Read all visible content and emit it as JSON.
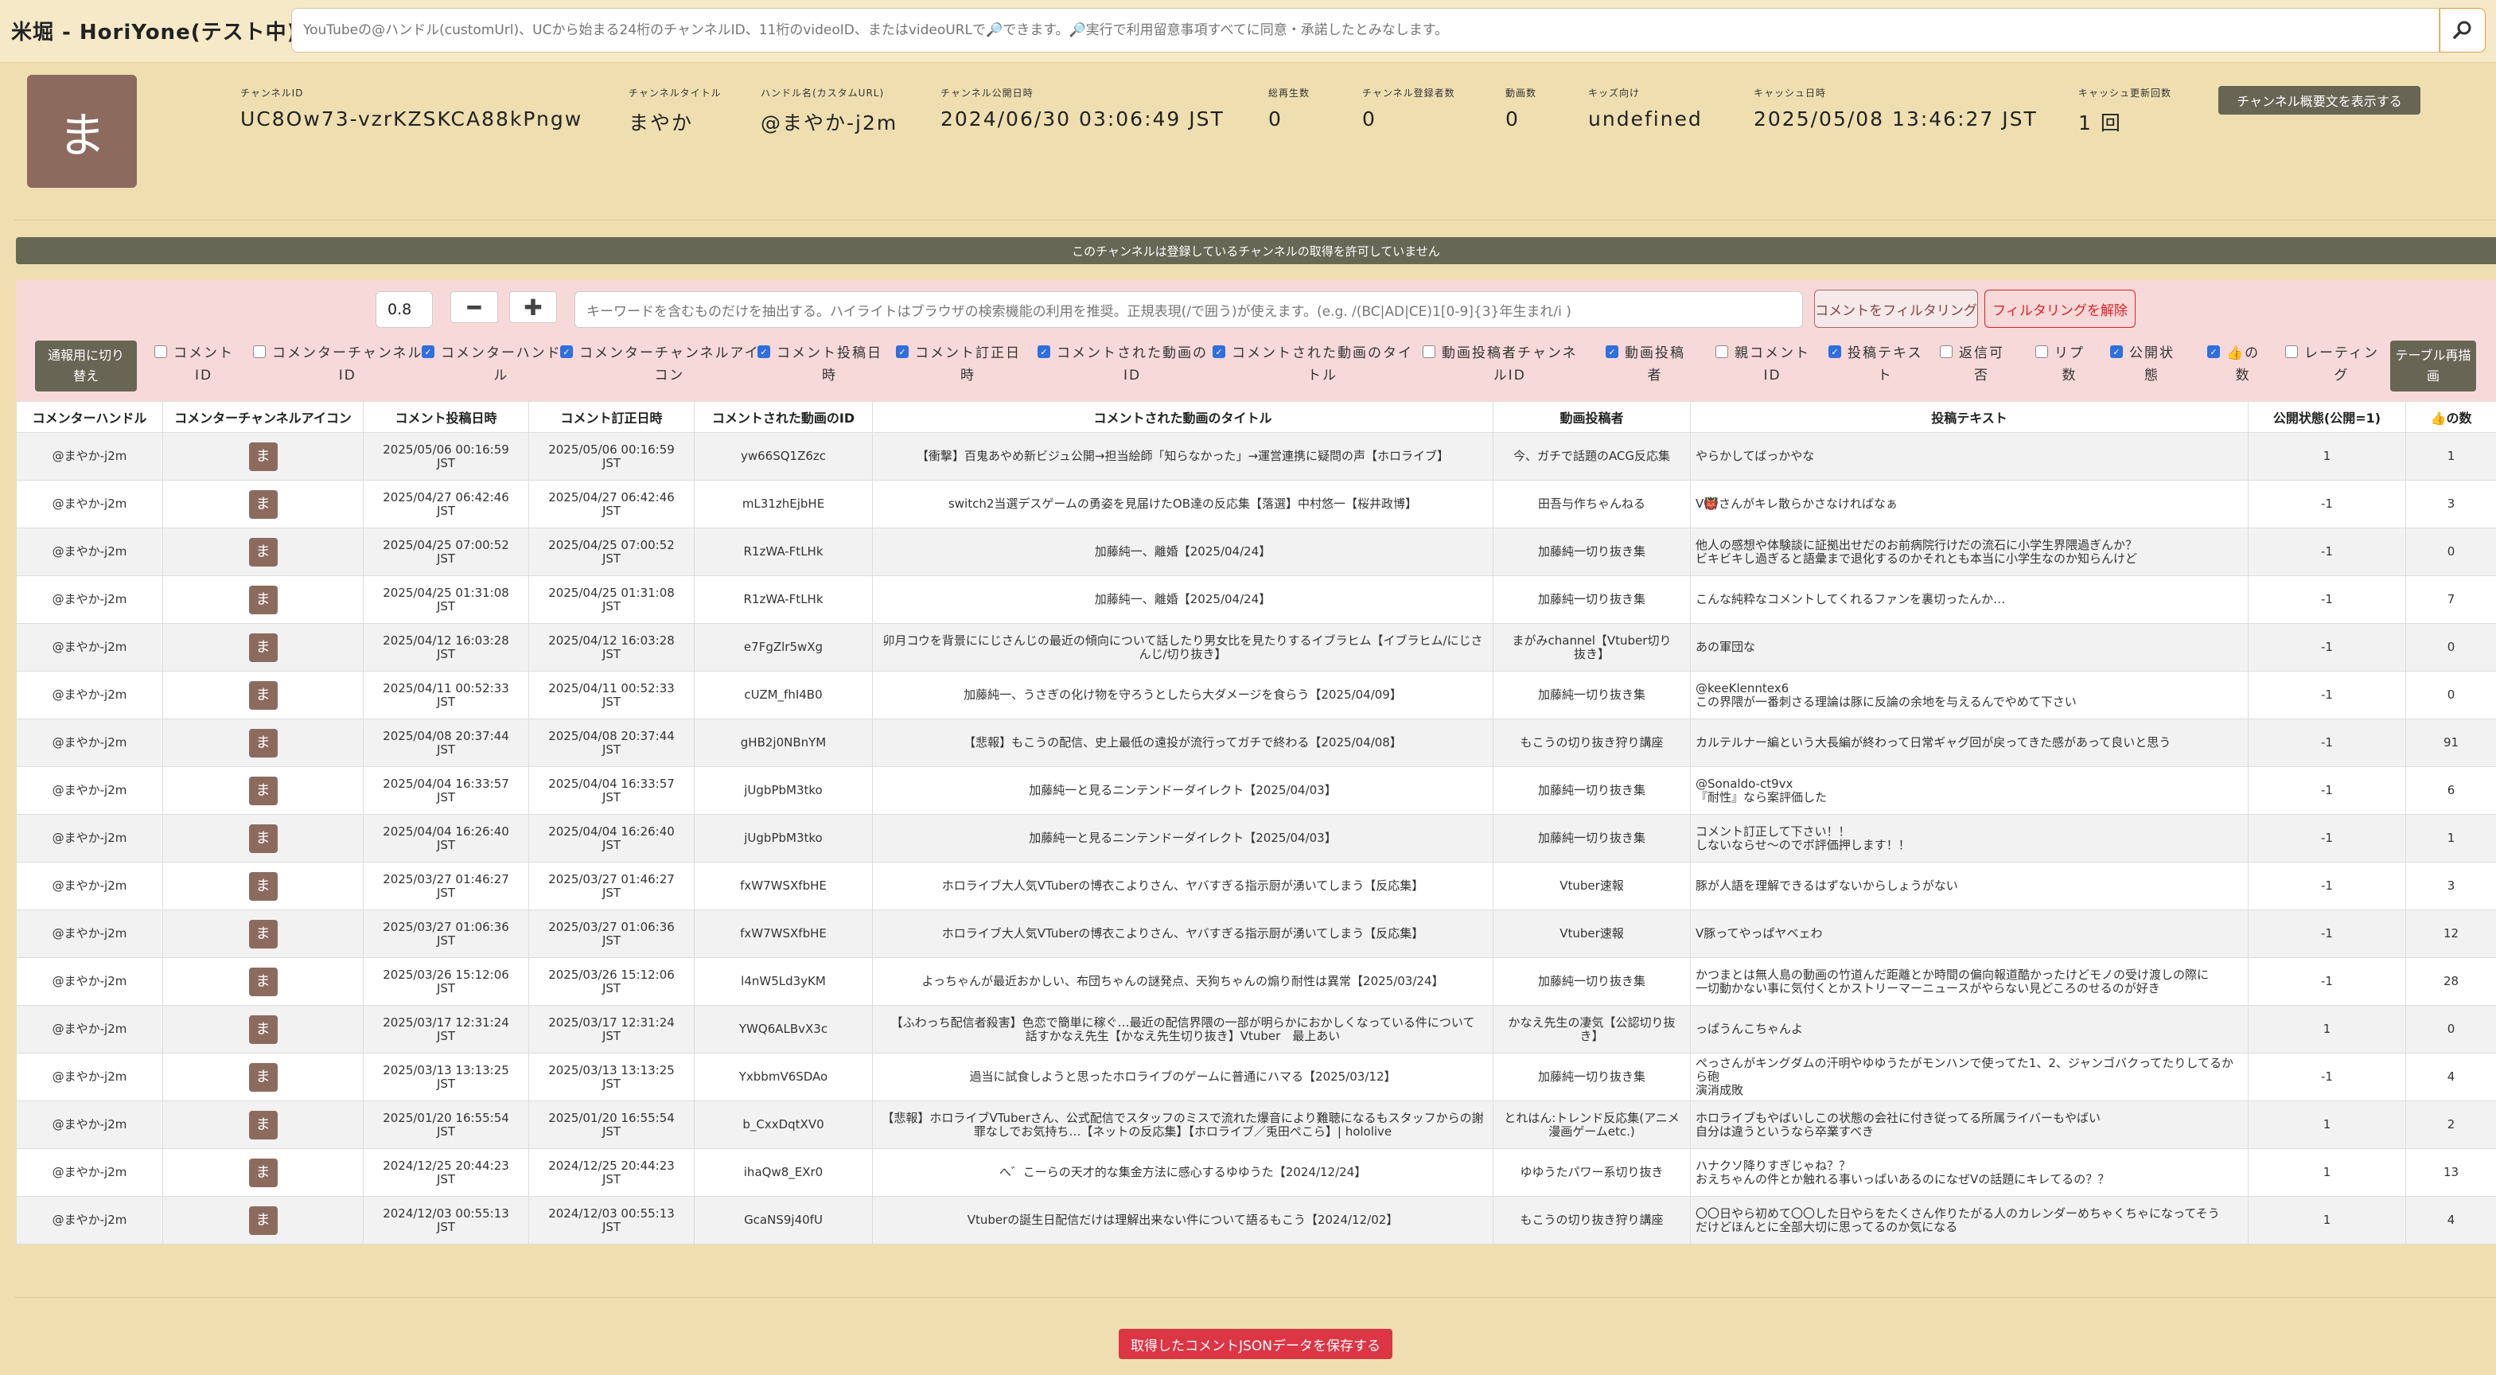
{
  "header": {
    "title": "米堀 - HoriYone(テスト中)",
    "search_placeholder": "YouTubeの@ハンドル(customUrl)、UCから始まる24桁のチャンネルID、11桁のvideoID、またはvideoURLで🔎できます。🔎実行で利用留意事項すべてに同意・承諾したとみなします。",
    "search_icon": "magnifier-icon"
  },
  "channel": {
    "avatar_char": "ま",
    "fields": [
      {
        "label": "チャンネルID",
        "value": "UC8Ow73-vzrKZSKCA88kPngw"
      },
      {
        "label": "チャンネルタイトル",
        "value": "まやか"
      },
      {
        "label": "ハンドル名(カスタムURL)",
        "value": "@まやか-j2m"
      },
      {
        "label": "チャンネル公開日時",
        "value": "2024/06/30 03:06:49 JST"
      },
      {
        "label": "総再生数",
        "value": "0"
      },
      {
        "label": "チャンネル登録者数",
        "value": "0"
      },
      {
        "label": "動画数",
        "value": "0"
      },
      {
        "label": "キッズ向け",
        "value": "undefined"
      },
      {
        "label": "キャッシュ日時",
        "value": "2025/05/08 13:46:27 JST"
      },
      {
        "label": "キャッシュ更新回数",
        "value": "1 回"
      }
    ],
    "description_button": "チャンネル概要文を表示する"
  },
  "notice": "このチャンネルは登録しているチャンネルの取得を許可していません",
  "filter": {
    "threshold": "0.8",
    "minus": "━",
    "plus": "✚",
    "keyword_placeholder": "キーワードを含むものだけを抽出する。ハイライトはブラウザの検索機能の利用を推奨。正規表現(/で囲う)が使えます。(e.g. /(BC|AD|CE)1[0-9]{3}年生まれ/i )",
    "filter_button": "コメントをフィルタリング",
    "clear_button": "フィルタリングを解除",
    "switch_button_l1": "通報用に切り",
    "switch_button_l2": "替え",
    "redraw_button_l1": "テーブル再描",
    "redraw_button_l2": "画"
  },
  "column_toggles": [
    {
      "l1": "コメント",
      "l2": "ID",
      "checked": false
    },
    {
      "l1": "コメンターチャンネル",
      "l2": "ID",
      "checked": false
    },
    {
      "l1": "コメンターハンド",
      "l2": "ル",
      "checked": true
    },
    {
      "l1": "コメンターチャンネルアイ",
      "l2": "コン",
      "checked": true
    },
    {
      "l1": "コメント投稿日",
      "l2": "時",
      "checked": true
    },
    {
      "l1": "コメント訂正日",
      "l2": "時",
      "checked": true
    },
    {
      "l1": "コメントされた動画の",
      "l2": "ID",
      "checked": true
    },
    {
      "l1": "コメントされた動画のタイ",
      "l2": "トル",
      "checked": true
    },
    {
      "l1": "動画投稿者チャンネ",
      "l2": "ルID",
      "checked": false
    },
    {
      "l1": "動画投稿",
      "l2": "者",
      "checked": true
    },
    {
      "l1": "親コメント",
      "l2": "ID",
      "checked": false
    },
    {
      "l1": "投稿テキス",
      "l2": "ト",
      "checked": true
    },
    {
      "l1": "返信可",
      "l2": "否",
      "checked": false
    },
    {
      "l1": "リプ",
      "l2": "数",
      "checked": false
    },
    {
      "l1": "公開状",
      "l2": "態",
      "checked": true
    },
    {
      "l1": "👍の",
      "l2": "数",
      "checked": true
    },
    {
      "l1": "レーティン",
      "l2": "グ",
      "checked": false
    }
  ],
  "table": {
    "headers": [
      "コメンターハンドル",
      "コメンターチャンネルアイコン",
      "コメント投稿日時",
      "コメント訂正日時",
      "コメントされた動画のID",
      "コメントされた動画のタイトル",
      "動画投稿者",
      "投稿テキスト",
      "公開状態(公開=1)",
      "👍の数"
    ],
    "rows": [
      {
        "handle": "@まやか-j2m",
        "icon": "ま",
        "posted_d": "2025/05/06 00:16:59",
        "posted_t": "JST",
        "edited_d": "2025/05/06 00:16:59",
        "edited_t": "JST",
        "video_id": "yw66SQ1Z6zc",
        "title1": "【衝撃】百鬼あやめ新ビジュ公開→担当絵師「知らなかった」→運営連携に疑問の声【ホロライブ】",
        "title2": "",
        "uploader1": "今、ガチで話題のACG反応集",
        "uploader2": "",
        "text1": "やらかしてばっかやな",
        "text2": "",
        "status": "1",
        "likes": "1"
      },
      {
        "handle": "@まやか-j2m",
        "icon": "ま",
        "posted_d": "2025/04/27 06:42:46",
        "posted_t": "JST",
        "edited_d": "2025/04/27 06:42:46",
        "edited_t": "JST",
        "video_id": "mL31zhEjbHE",
        "title1": "switch2当選デスゲームの勇姿を見届けたOB達の反応集【落選】中村悠一【桜井政博】",
        "title2": "",
        "uploader1": "田吾与作ちゃんねる",
        "uploader2": "",
        "text1": "V👹さんがキレ散らかさなければなぁ",
        "text2": "",
        "status": "-1",
        "likes": "3"
      },
      {
        "handle": "@まやか-j2m",
        "icon": "ま",
        "posted_d": "2025/04/25 07:00:52",
        "posted_t": "JST",
        "edited_d": "2025/04/25 07:00:52",
        "edited_t": "JST",
        "video_id": "R1zWA-FtLHk",
        "title1": "加藤純一、離婚【2025/04/24】",
        "title2": "",
        "uploader1": "加藤純一切り抜き集",
        "uploader2": "",
        "text1": "他人の感想や体験談に証拠出せだのお前病院行けだの流石に小学生界隈過ぎんか？",
        "text2": "ビキビキし過ぎると語彙まで退化するのかそれとも本当に小学生なのか知らんけど",
        "status": "-1",
        "likes": "0"
      },
      {
        "handle": "@まやか-j2m",
        "icon": "ま",
        "posted_d": "2025/04/25 01:31:08",
        "posted_t": "JST",
        "edited_d": "2025/04/25 01:31:08",
        "edited_t": "JST",
        "video_id": "R1zWA-FtLHk",
        "title1": "加藤純一、離婚【2025/04/24】",
        "title2": "",
        "uploader1": "加藤純一切り抜き集",
        "uploader2": "",
        "text1": "こんな純粋なコメントしてくれるファンを裏切ったんか…",
        "text2": "",
        "status": "-1",
        "likes": "7"
      },
      {
        "handle": "@まやか-j2m",
        "icon": "ま",
        "posted_d": "2025/04/12 16:03:28",
        "posted_t": "JST",
        "edited_d": "2025/04/12 16:03:28",
        "edited_t": "JST",
        "video_id": "e7FgZlr5wXg",
        "title1": "卯月コウを背景ににじさんじの最近の傾向について話したり男女比を見たりするイブラヒム【イブラヒム/にじさ",
        "title2": "んじ/切り抜き】",
        "uploader1": "まがみchannel【Vtuber切り",
        "uploader2": "抜き】",
        "text1": "あの軍団な",
        "text2": "",
        "status": "-1",
        "likes": "0"
      },
      {
        "handle": "@まやか-j2m",
        "icon": "ま",
        "posted_d": "2025/04/11 00:52:33",
        "posted_t": "JST",
        "edited_d": "2025/04/11 00:52:33",
        "edited_t": "JST",
        "video_id": "cUZM_fhI4B0",
        "title1": "加藤純一、うさぎの化け物を守ろうとしたら大ダメージを食らう【2025/04/09】",
        "title2": "",
        "uploader1": "加藤純一切り抜き集",
        "uploader2": "",
        "text1": "@keeKlenntex6",
        "text2": "この界隈が一番刺さる理論は豚に反論の余地を与えるんでやめて下さい",
        "status": "-1",
        "likes": "0"
      },
      {
        "handle": "@まやか-j2m",
        "icon": "ま",
        "posted_d": "2025/04/08 20:37:44",
        "posted_t": "JST",
        "edited_d": "2025/04/08 20:37:44",
        "edited_t": "JST",
        "video_id": "gHB2j0NBnYM",
        "title1": "【悲報】もこうの配信、史上最低の遠投が流行ってガチで終わる【2025/04/08】",
        "title2": "",
        "uploader1": "もこうの切り抜き狩り講座",
        "uploader2": "",
        "text1": "カルテルナー編という大長編が終わって日常ギャグ回が戻ってきた感があって良いと思う",
        "text2": "",
        "status": "-1",
        "likes": "91"
      },
      {
        "handle": "@まやか-j2m",
        "icon": "ま",
        "posted_d": "2025/04/04 16:33:57",
        "posted_t": "JST",
        "edited_d": "2025/04/04 16:33:57",
        "edited_t": "JST",
        "video_id": "jUgbPbM3tko",
        "title1": "加藤純一と見るニンテンドーダイレクト【2025/04/03】",
        "title2": "",
        "uploader1": "加藤純一切り抜き集",
        "uploader2": "",
        "text1": "@Sonaldo-ct9vx",
        "text2": "『耐性』なら案評価した",
        "status": "-1",
        "likes": "6"
      },
      {
        "handle": "@まやか-j2m",
        "icon": "ま",
        "posted_d": "2025/04/04 16:26:40",
        "posted_t": "JST",
        "edited_d": "2025/04/04 16:26:40",
        "edited_t": "JST",
        "video_id": "jUgbPbM3tko",
        "title1": "加藤純一と見るニンテンドーダイレクト【2025/04/03】",
        "title2": "",
        "uploader1": "加藤純一切り抜き集",
        "uploader2": "",
        "text1": "コメント訂正して下さい！！",
        "text2": "しないならせ〜のでボ評価押します！！",
        "status": "-1",
        "likes": "1"
      },
      {
        "handle": "@まやか-j2m",
        "icon": "ま",
        "posted_d": "2025/03/27 01:46:27",
        "posted_t": "JST",
        "edited_d": "2025/03/27 01:46:27",
        "edited_t": "JST",
        "video_id": "fxW7WSXfbHE",
        "title1": "ホロライブ大人気VTuberの博衣こよりさん、ヤバすぎる指示厨が湧いてしまう【反応集】",
        "title2": "",
        "uploader1": "Vtuber速報",
        "uploader2": "",
        "text1": "豚が人語を理解できるはずないからしょうがない",
        "text2": "",
        "status": "-1",
        "likes": "3"
      },
      {
        "handle": "@まやか-j2m",
        "icon": "ま",
        "posted_d": "2025/03/27 01:06:36",
        "posted_t": "JST",
        "edited_d": "2025/03/27 01:06:36",
        "edited_t": "JST",
        "video_id": "fxW7WSXfbHE",
        "title1": "ホロライブ大人気VTuberの博衣こよりさん、ヤバすぎる指示厨が湧いてしまう【反応集】",
        "title2": "",
        "uploader1": "Vtuber速報",
        "uploader2": "",
        "text1": "V豚ってやっぱヤベェわ",
        "text2": "",
        "status": "-1",
        "likes": "12"
      },
      {
        "handle": "@まやか-j2m",
        "icon": "ま",
        "posted_d": "2025/03/26 15:12:06",
        "posted_t": "JST",
        "edited_d": "2025/03/26 15:12:06",
        "edited_t": "JST",
        "video_id": "l4nW5Ld3yKM",
        "title1": "よっちゃんが最近おかしい、布団ちゃんの謎発点、天狗ちゃんの煽り耐性は異常【2025/03/24】",
        "title2": "",
        "uploader1": "加藤純一切り抜き集",
        "uploader2": "",
        "text1": "かつまとは無人島の動画の竹道んだ距離とか時間の偏向報道酷かったけどモノの受け渡しの際に",
        "text2": "一切動かない事に気付くとかストリーマーニュースがやらない見どころのせるのが好き",
        "status": "-1",
        "likes": "28"
      },
      {
        "handle": "@まやか-j2m",
        "icon": "ま",
        "posted_d": "2025/03/17 12:31:24",
        "posted_t": "JST",
        "edited_d": "2025/03/17 12:31:24",
        "edited_t": "JST",
        "video_id": "YWQ6ALBvX3c",
        "title1": "【ふわっち配信者殺害】色恋で簡単に稼ぐ…最近の配信界隈の一部が明らかにおかしくなっている件について",
        "title2": "話すかなえ先生【かなえ先生切り抜き】Vtuber　最上あい",
        "uploader1": "かなえ先生の凄気【公認切り抜",
        "uploader2": "き】",
        "text1": "っぱうんこちゃんよ",
        "text2": "",
        "status": "1",
        "likes": "0"
      },
      {
        "handle": "@まやか-j2m",
        "icon": "ま",
        "posted_d": "2025/03/13 13:13:25",
        "posted_t": "JST",
        "edited_d": "2025/03/13 13:13:25",
        "edited_t": "JST",
        "video_id": "YxbbmV6SDAo",
        "title1": "過当に試食しようと思ったホロライブのゲームに普通にハマる【2025/03/12】",
        "title2": "",
        "uploader1": "加藤純一切り抜き集",
        "uploader2": "",
        "text1": "ぺっさんがキングダムの汗明やゆゆうたがモンハンで使ってた1、2、ジャンゴバクってたりしてるから砲",
        "text2": "演消成敗",
        "status": "-1",
        "likes": "4"
      },
      {
        "handle": "@まやか-j2m",
        "icon": "ま",
        "posted_d": "2025/01/20 16:55:54",
        "posted_t": "JST",
        "edited_d": "2025/01/20 16:55:54",
        "edited_t": "JST",
        "video_id": "b_CxxDqtXV0",
        "title1": "【悲報】ホロライブVTuberさん、公式配信でスタッフのミスで流れた爆音により難聴になるもスタッフからの謝",
        "title2": "罪なしでお気持ち…【ネットの反応集】【ホロライブ／兎田ぺこら】| hololive",
        "uploader1": "とれはん:トレンド反応集(アニメ",
        "uploader2": "漫画ゲームetc.)",
        "text1": "ホロライブもやばいしこの状態の会社に付き従ってる所属ライバーもやばい",
        "text2": "自分は違うというなら卒業すべき",
        "status": "1",
        "likes": "2"
      },
      {
        "handle": "@まやか-j2m",
        "icon": "ま",
        "posted_d": "2024/12/25 20:44:23",
        "posted_t": "JST",
        "edited_d": "2024/12/25 20:44:23",
        "edited_t": "JST",
        "video_id": "ihaQw8_EXr0",
        "title1": "へ゛こーらの天才的な集金方法に感心するゆゆうた【2024/12/24】",
        "title2": "",
        "uploader1": "ゆゆうたパワー系切り抜き",
        "uploader2": "",
        "text1": "ハナクソ降りすぎじゃね？？",
        "text2": "おえちゃんの件とか触れる事いっぱいあるのになぜVの話題にキレてるの？？",
        "status": "1",
        "likes": "13"
      },
      {
        "handle": "@まやか-j2m",
        "icon": "ま",
        "posted_d": "2024/12/03 00:55:13",
        "posted_t": "JST",
        "edited_d": "2024/12/03 00:55:13",
        "edited_t": "JST",
        "video_id": "GcaNS9j40fU",
        "title1": "Vtuberの誕生日配信だけは理解出来ない件について語るもこう【2024/12/02】",
        "title2": "",
        "uploader1": "もこうの切り抜き狩り講座",
        "uploader2": "",
        "text1": "〇〇日やら初めて〇〇した日やらをたくさん作りたがる人のカレンダーめちゃくちゃになってそう",
        "text2": "だけどほんとに全部大切に思ってるのか気になる",
        "status": "1",
        "likes": "4"
      }
    ]
  },
  "save_button": "取得したコメントJSONデータを保存する"
}
